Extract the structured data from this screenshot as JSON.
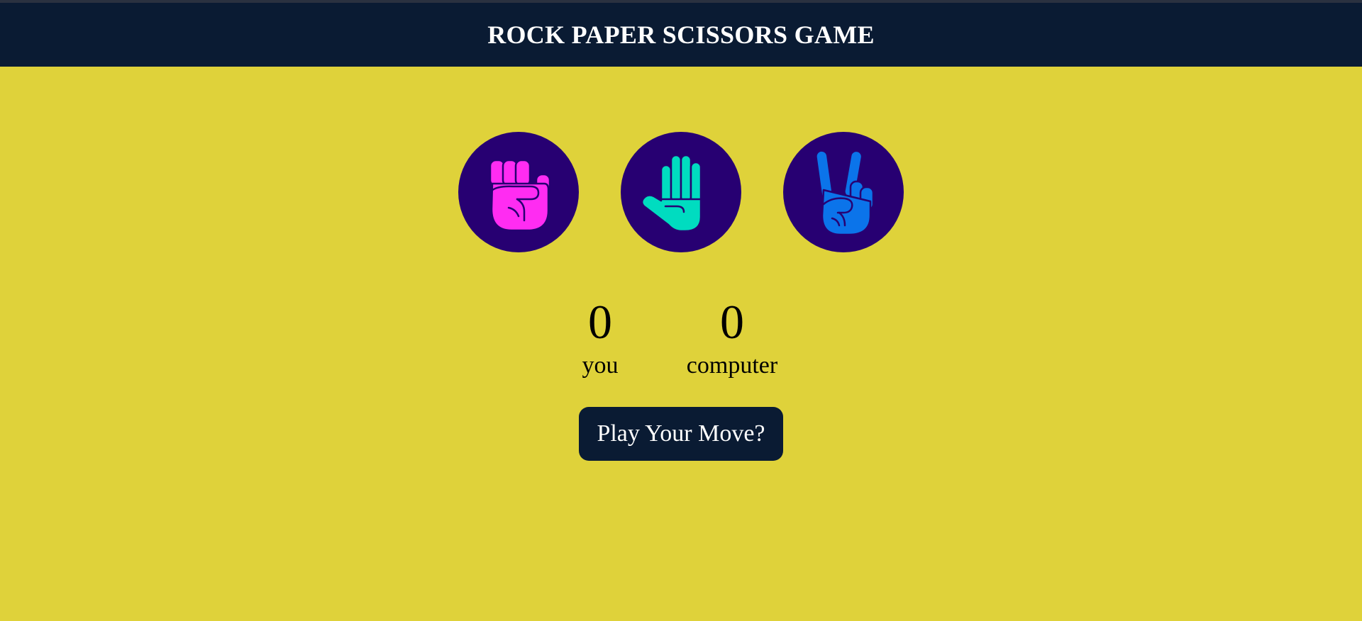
{
  "header": {
    "title": "ROCK PAPER SCISSORS GAME"
  },
  "choices": [
    {
      "name": "rock",
      "icon": "rock-fist-icon",
      "color": "#ff2cf2"
    },
    {
      "name": "paper",
      "icon": "paper-hand-icon",
      "color": "#00dcc0"
    },
    {
      "name": "scissors",
      "icon": "scissors-peace-icon",
      "color": "#0b74ea"
    }
  ],
  "scores": {
    "you": {
      "value": "0",
      "label": "you"
    },
    "computer": {
      "value": "0",
      "label": "computer"
    }
  },
  "play_button": {
    "label": "Play Your Move?"
  },
  "colors": {
    "background": "#dfd23a",
    "header": "#0a1b33",
    "circle": "#270072",
    "button": "#0a1b33",
    "rock": "#ff2cf2",
    "paper": "#00dcc0",
    "scissors": "#0b74ea"
  }
}
